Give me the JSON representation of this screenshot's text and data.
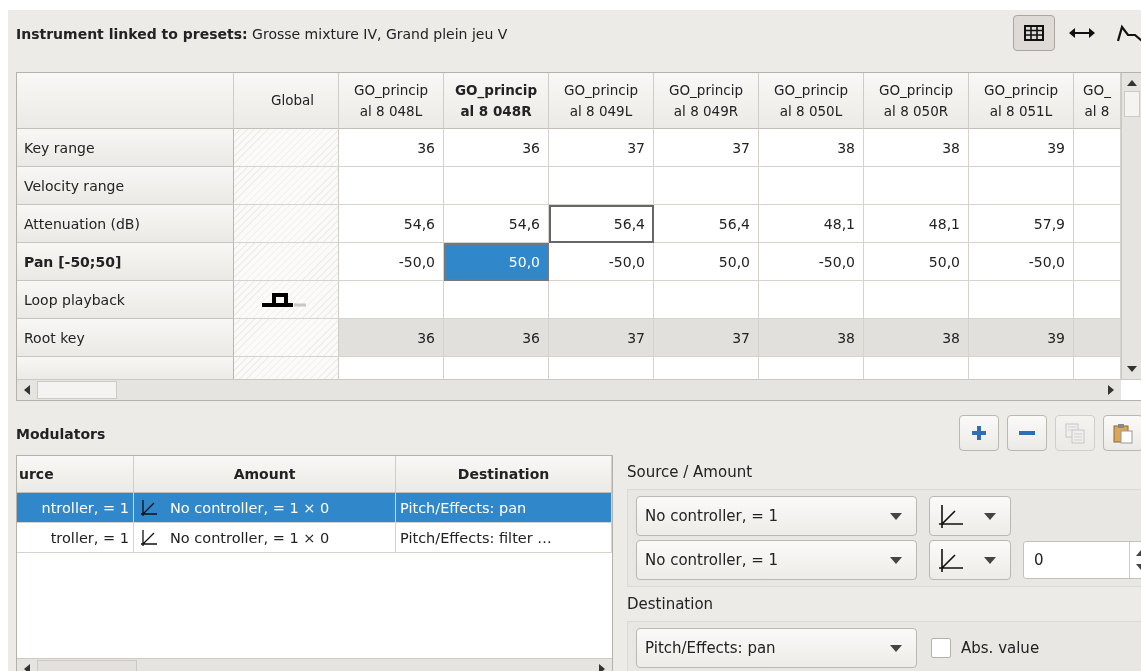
{
  "header": {
    "title": "**Instrument linked to presets:** Grosse mixture IV, Grand plein jeu V",
    "views": [
      {
        "kind": "table",
        "selected": true
      },
      {
        "kind": "range",
        "selected": false
      },
      {
        "kind": "envelope",
        "selected": false
      }
    ]
  },
  "table": {
    "global_label": "Global",
    "columns": [
      {
        "lines": [
          "GO_princip",
          "al 8 048L"
        ],
        "current": false
      },
      {
        "lines": [
          "GO_princip",
          "al 8 048R"
        ],
        "current": true
      },
      {
        "lines": [
          "GO_princip",
          "al 8 049L"
        ],
        "current": false
      },
      {
        "lines": [
          "GO_princip",
          "al 8 049R"
        ],
        "current": false
      },
      {
        "lines": [
          "GO_princip",
          "al 8 050L"
        ],
        "current": false
      },
      {
        "lines": [
          "GO_princip",
          "al 8 050R"
        ],
        "current": false
      },
      {
        "lines": [
          "GO_princip",
          "al 8 051L"
        ],
        "current": false
      },
      {
        "lines": [
          "GO_",
          "al 8"
        ],
        "current": false
      }
    ],
    "rows": [
      {
        "label": "Key range",
        "current": false,
        "shaded": false,
        "cells": [
          {
            "text": "36",
            "selected": false,
            "focused": false
          },
          {
            "text": "36",
            "selected": false,
            "focused": false
          },
          {
            "text": "37",
            "selected": false,
            "focused": false
          },
          {
            "text": "37",
            "selected": false,
            "focused": false
          },
          {
            "text": "38",
            "selected": false,
            "focused": false
          },
          {
            "text": "38",
            "selected": false,
            "focused": false
          },
          {
            "text": "39",
            "selected": false,
            "focused": false
          },
          {
            "selected": false,
            "focused": false
          }
        ]
      },
      {
        "label": "Velocity range",
        "current": false,
        "shaded": false,
        "cells": [
          {
            "selected": false,
            "focused": false
          },
          {
            "selected": false,
            "focused": false
          },
          {
            "selected": false,
            "focused": false
          },
          {
            "selected": false,
            "focused": false
          },
          {
            "selected": false,
            "focused": false
          },
          {
            "selected": false,
            "focused": false
          },
          {
            "selected": false,
            "focused": false
          },
          {
            "selected": false,
            "focused": false
          }
        ]
      },
      {
        "label": "Attenuation (dB)",
        "current": false,
        "shaded": false,
        "cells": [
          {
            "text": "54,6",
            "selected": false,
            "focused": false
          },
          {
            "text": "54,6",
            "selected": false,
            "focused": false
          },
          {
            "text": "56,4",
            "selected": false,
            "focused": true
          },
          {
            "text": "56,4",
            "selected": false,
            "focused": false
          },
          {
            "text": "48,1",
            "selected": false,
            "focused": false
          },
          {
            "text": "48,1",
            "selected": false,
            "focused": false
          },
          {
            "text": "57,9",
            "selected": false,
            "focused": false
          },
          {
            "selected": false,
            "focused": false
          }
        ]
      },
      {
        "label": "Pan [-50;50]",
        "current": true,
        "shaded": false,
        "cells": [
          {
            "text": "-50,0",
            "selected": false,
            "focused": false
          },
          {
            "text": "50,0",
            "selected": true,
            "focused": false
          },
          {
            "text": "-50,0",
            "selected": false,
            "focused": false
          },
          {
            "text": "50,0",
            "selected": false,
            "focused": false
          },
          {
            "text": "-50,0",
            "selected": false,
            "focused": false
          },
          {
            "text": "50,0",
            "selected": false,
            "focused": false
          },
          {
            "text": "-50,0",
            "selected": false,
            "focused": false
          },
          {
            "selected": false,
            "focused": false
          }
        ]
      },
      {
        "label": "Loop playback",
        "current": false,
        "shaded": false,
        "global": {
          "kind": "loop"
        },
        "cells": [
          {
            "selected": false,
            "focused": false
          },
          {
            "selected": false,
            "focused": false
          },
          {
            "selected": false,
            "focused": false
          },
          {
            "selected": false,
            "focused": false
          },
          {
            "selected": false,
            "focused": false
          },
          {
            "selected": false,
            "focused": false
          },
          {
            "selected": false,
            "focused": false
          },
          {
            "selected": false,
            "focused": false
          }
        ]
      },
      {
        "label": "Root key",
        "current": false,
        "shaded": true,
        "cells": [
          {
            "text": "36",
            "selected": false,
            "focused": false
          },
          {
            "text": "36",
            "selected": false,
            "focused": false
          },
          {
            "text": "37",
            "selected": false,
            "focused": false
          },
          {
            "text": "37",
            "selected": false,
            "focused": false
          },
          {
            "text": "38",
            "selected": false,
            "focused": false
          },
          {
            "text": "38",
            "selected": false,
            "focused": false
          },
          {
            "text": "39",
            "selected": false,
            "focused": false
          },
          {
            "selected": false,
            "focused": false
          }
        ]
      }
    ]
  },
  "modulators": {
    "title": "Modulators",
    "buttons": [
      {
        "kind": "add",
        "disabled": false
      },
      {
        "kind": "remove",
        "disabled": false
      },
      {
        "kind": "copy",
        "disabled": true
      },
      {
        "kind": "paste",
        "disabled": false
      }
    ],
    "columns": [
      "urce",
      "Amount",
      "Destination"
    ],
    "rows": [
      {
        "source": "ntroller, = 1",
        "amount": "No controller, = 1 × 0",
        "destination": "Pitch/Effects: pan",
        "selected": true
      },
      {
        "source": "troller, = 1",
        "amount": "No controller, = 1 × 0",
        "destination": "Pitch/Effects: filter …",
        "selected": false
      }
    ]
  },
  "editor": {
    "source_label": "Source / Amount",
    "source": "No controller, = 1",
    "amount_source": "No controller, = 1",
    "amount": "0",
    "destination_label": "Destination",
    "destination": "Pitch/Effects: pan",
    "abs_value": {
      "label": "Abs. value",
      "checked": false
    }
  }
}
